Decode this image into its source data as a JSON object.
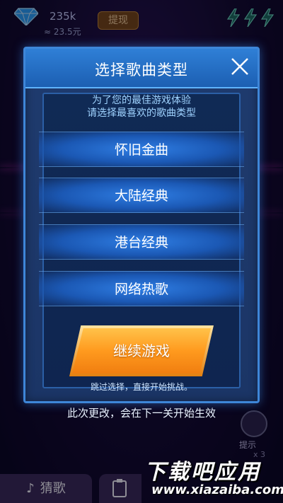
{
  "status": {
    "coins": "235k",
    "coins_rmb": "≈ 23.5元",
    "withdraw_label": "提现"
  },
  "dialog": {
    "title": "选择歌曲类型",
    "subtitle_line1": "为了您的最佳游戏体验",
    "subtitle_line2": "请选择最喜欢的歌曲类型",
    "genres": [
      {
        "label": "怀旧金曲"
      },
      {
        "label": "大陆经典"
      },
      {
        "label": "港台经典"
      },
      {
        "label": "网络热歌"
      }
    ],
    "continue_label": "继续游戏",
    "skip_text": "跳过选择，直接开始挑战。"
  },
  "footer_note": "此次更改，会在下一关开始生效",
  "hint": {
    "label": "提示",
    "count": "x 3"
  },
  "bottom_bar": {
    "guess_tab": "猜歌"
  },
  "watermark": {
    "title": "下载吧应用",
    "url": "www.xiazaiba.com"
  },
  "colors": {
    "dialog_border": "#3e86d8",
    "header": "#2f7fd6",
    "genre_button": "#2f7ee4",
    "continue_button": "#ff9a1e",
    "subtitle_text": "#9fd3ff"
  },
  "icons": [
    "diamond-icon",
    "energy-icon",
    "close-icon",
    "music-note-icon",
    "clipboard-icon",
    "hint-bulb-icon"
  ]
}
